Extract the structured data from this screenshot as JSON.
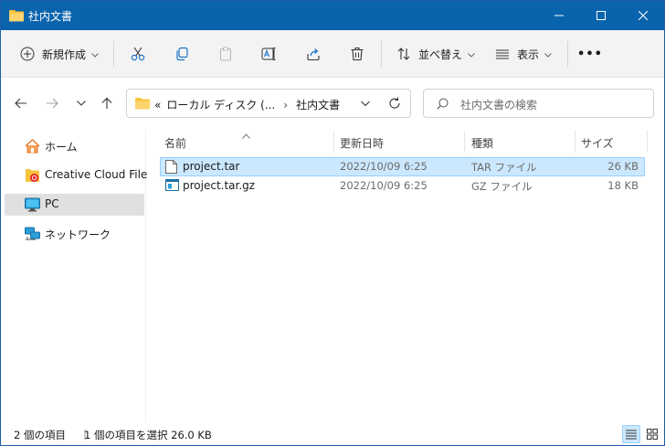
{
  "window": {
    "title": "社内文書"
  },
  "toolbar": {
    "new_label": "新規作成",
    "sort_label": "並べ替え",
    "view_label": "表示",
    "more_label": "•••"
  },
  "address": {
    "prefix": "«",
    "crumbs": [
      "ローカル ディスク (...",
      "社内文書"
    ],
    "separator": "›"
  },
  "search": {
    "placeholder": "社内文書の検索"
  },
  "sidebar": {
    "items": [
      {
        "label": "ホーム",
        "icon": "home-icon"
      },
      {
        "label": "Creative Cloud Files",
        "icon": "creative-cloud-icon"
      },
      {
        "label": "PC",
        "icon": "pc-icon",
        "selected": true
      },
      {
        "label": "ネットワーク",
        "icon": "network-icon"
      }
    ]
  },
  "columns": {
    "name": "名前",
    "modified": "更新日時",
    "type": "種類",
    "size": "サイズ"
  },
  "files": [
    {
      "name": "project.tar",
      "modified": "2022/10/09 6:25",
      "type": "TAR ファイル",
      "size": "26 KB",
      "selected": true
    },
    {
      "name": "project.tar.gz",
      "modified": "2022/10/09 6:25",
      "type": "GZ ファイル",
      "size": "18 KB",
      "selected": false
    }
  ],
  "status": {
    "item_count": "2 個の項目",
    "selection": "1 個の項目を選択  26.0 KB"
  },
  "colors": {
    "titlebar": "#0a64ad",
    "selection": "#cce8ff",
    "selection_border": "#99d1ff",
    "folder": "#f8c33d"
  }
}
